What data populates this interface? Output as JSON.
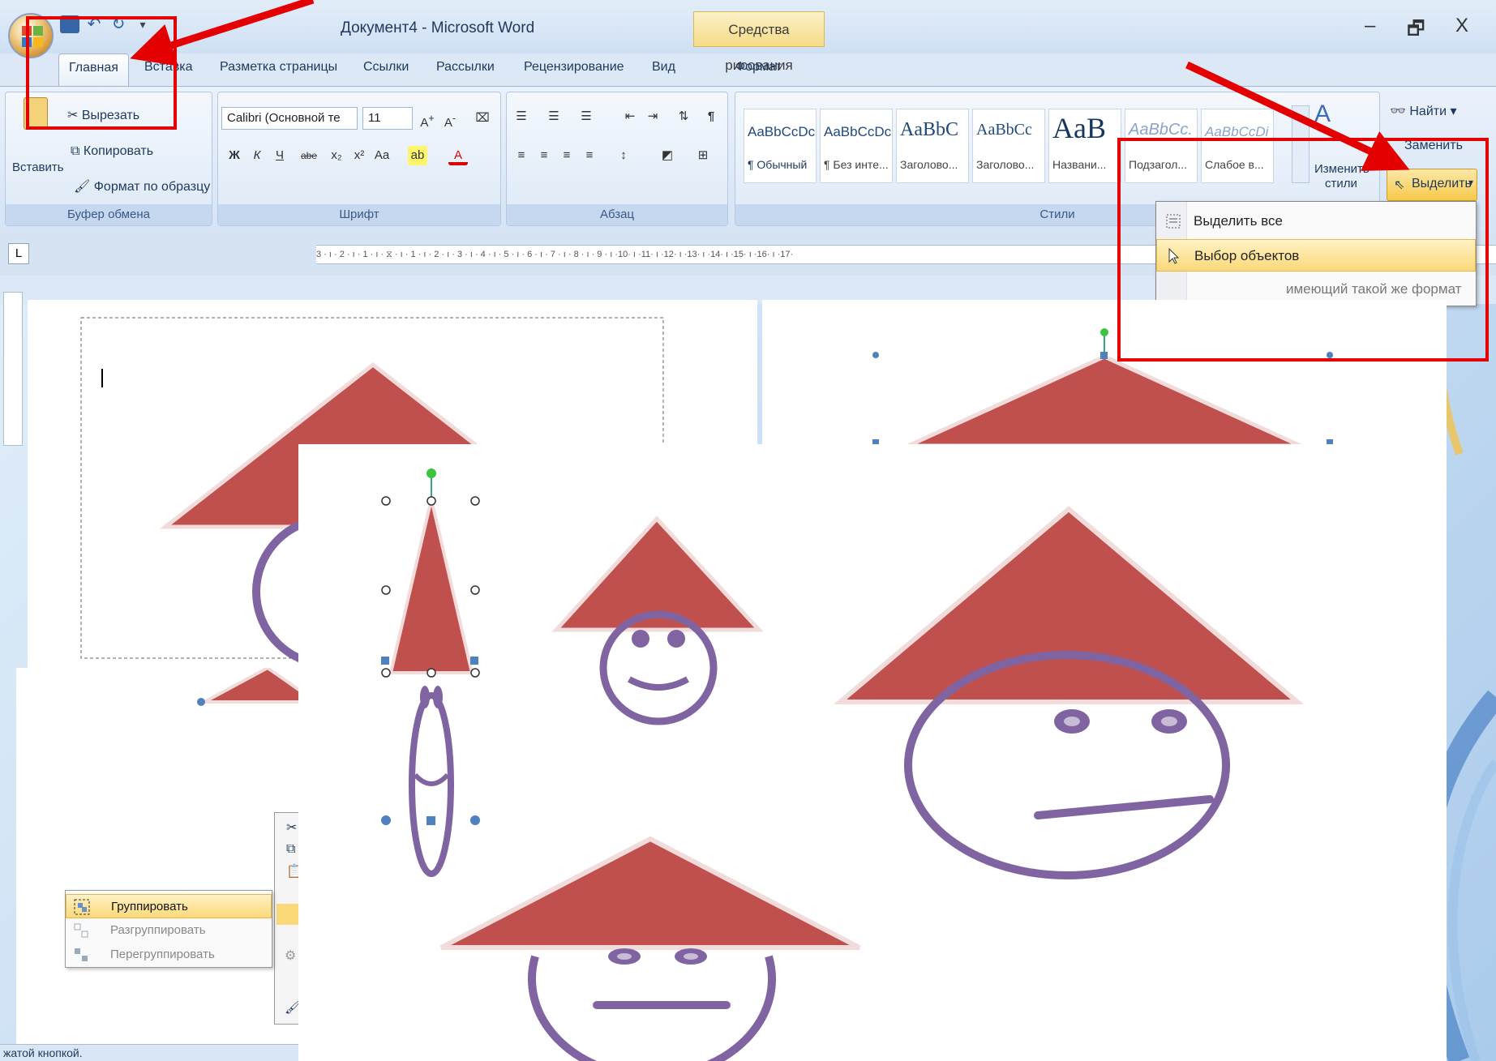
{
  "window": {
    "title": "Документ4 - Microsoft Word",
    "contextual_tab_group": "Средства рисования",
    "controls": {
      "minimize": "–",
      "restore": "🗗",
      "close": "X"
    }
  },
  "tabs": [
    {
      "label": "Главная",
      "active": true
    },
    {
      "label": "Вставка"
    },
    {
      "label": "Разметка страницы"
    },
    {
      "label": "Ссылки"
    },
    {
      "label": "Рассылки"
    },
    {
      "label": "Рецензирование"
    },
    {
      "label": "Вид"
    },
    {
      "label": "Формат"
    }
  ],
  "clipboard": {
    "paste": "Вставить",
    "cut": "Вырезать",
    "copy": "Копировать",
    "format_painter": "Формат по образцу",
    "label": "Буфер обмена"
  },
  "font": {
    "font_name": "Calibri (Основной те",
    "font_size": "11",
    "label": "Шрифт"
  },
  "paragraph": {
    "label": "Абзац"
  },
  "styles": {
    "label": "Стили",
    "items": [
      {
        "sample": "AaBbCcDc",
        "name": "¶ Обычный"
      },
      {
        "sample": "AaBbCcDc",
        "name": "¶ Без инте..."
      },
      {
        "sample": "AaBbC",
        "name": "Заголово..."
      },
      {
        "sample": "AaBbCc",
        "name": "Заголово..."
      },
      {
        "sample": "AaB",
        "name": "Названи..."
      },
      {
        "sample": "AaBbCc.",
        "name": "Подзагол..."
      },
      {
        "sample": "AaBbCcDi",
        "name": "Слабое в..."
      }
    ],
    "change_styles": "Изменить стили"
  },
  "editing": {
    "find": "Найти",
    "replace": "Заменить",
    "select": "Выделить"
  },
  "ruler": {
    "marks": "3 · ı · 2 · ı · 1 · ı · ⧖ · ı · 1 · ı · 2 · ı · 3 · ı · 4 · ı · 5 · ı · 6 · ı · 7 · ı · 8 · ı · 9 · ı ·10· ı ·11· ı ·12· ı ·13· ı ·14· ı ·15· ı ·16· ı ·17·"
  },
  "select_menu": [
    {
      "label": "Выделить все",
      "underline": "в"
    },
    {
      "label": "Выбор объектов",
      "underline": "т",
      "highlighted": true
    },
    {
      "label": "имеющий такой же формат"
    }
  ],
  "context_menu": [
    {
      "label": "Группировать",
      "active": true
    },
    {
      "label": "Разгруппировать"
    },
    {
      "label": "Перегруппировать"
    }
  ],
  "status_text": "жатой кнопкой.",
  "colors": {
    "hat": "#c0504d",
    "face": "#8064a2",
    "annotation": "#e40000",
    "handle": "#4f81bd",
    "rotate_handle": "#3cc43c"
  }
}
